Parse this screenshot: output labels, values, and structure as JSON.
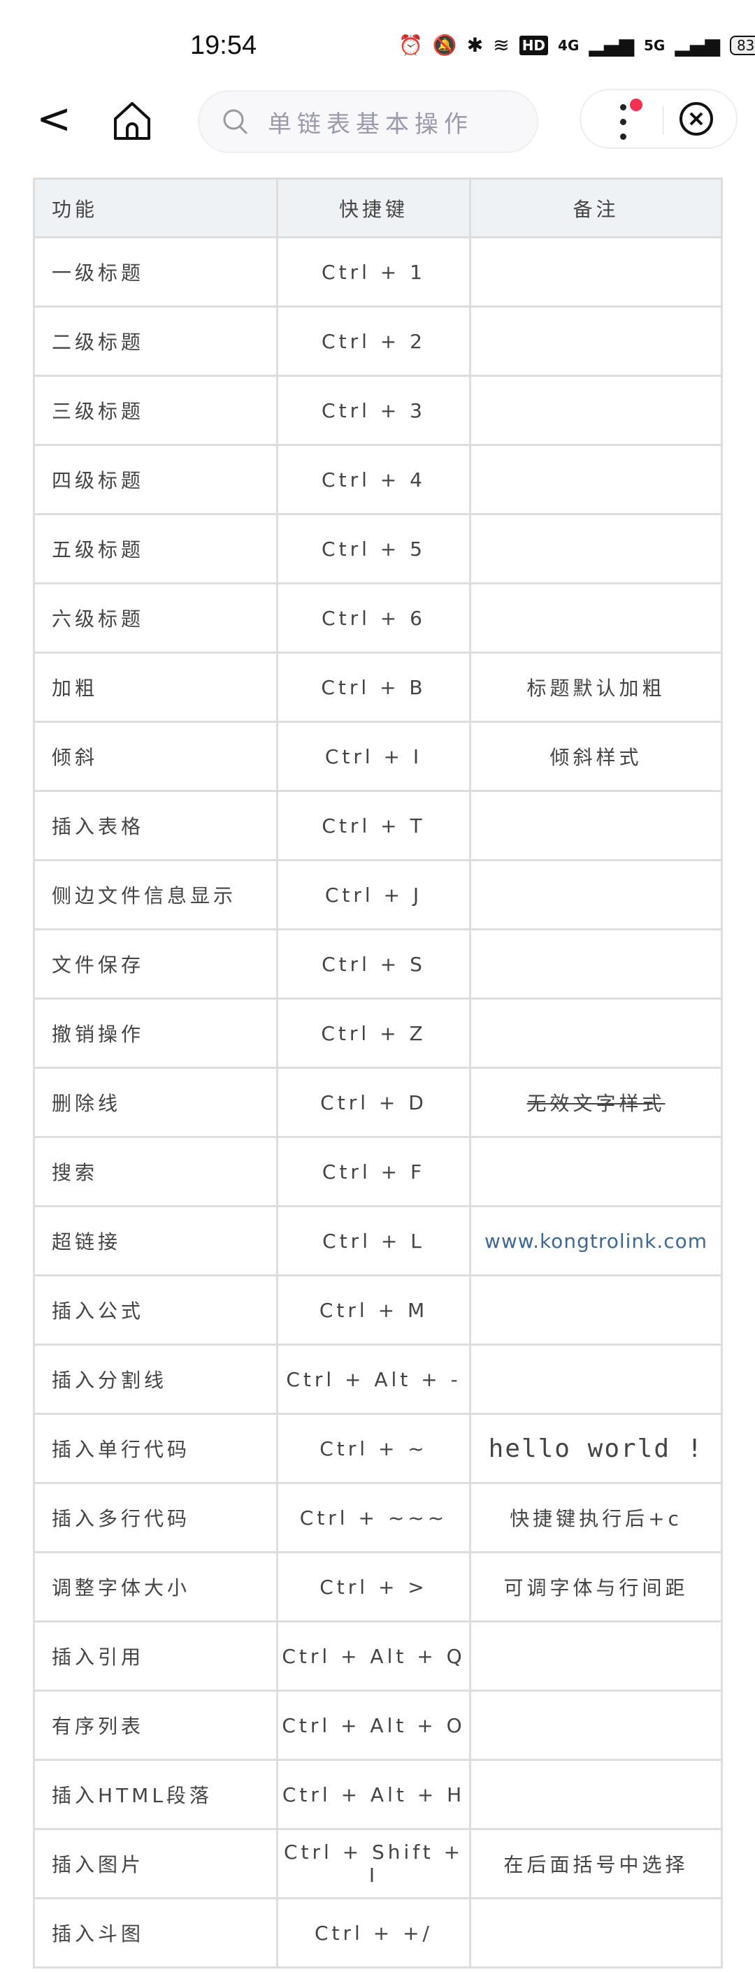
{
  "status_bar": {
    "time": "19:54",
    "battery": "83",
    "network1": "4G",
    "network2": "5G",
    "hd": "HD"
  },
  "nav": {
    "search_placeholder": "单链表基本操作"
  },
  "table": {
    "headers": [
      "功能",
      "快捷键",
      "备注"
    ],
    "rows": [
      {
        "func": "一级标题",
        "key": "Ctrl + 1",
        "note": ""
      },
      {
        "func": "二级标题",
        "key": "Ctrl + 2",
        "note": ""
      },
      {
        "func": "三级标题",
        "key": "Ctrl + 3",
        "note": ""
      },
      {
        "func": "四级标题",
        "key": "Ctrl + 4",
        "note": ""
      },
      {
        "func": "五级标题",
        "key": "Ctrl + 5",
        "note": ""
      },
      {
        "func": "六级标题",
        "key": "Ctrl + 6",
        "note": ""
      },
      {
        "func": "加粗",
        "key": "Ctrl + B",
        "note": "标题默认加粗"
      },
      {
        "func": "倾斜",
        "key": "Ctrl + I",
        "note": "倾斜样式"
      },
      {
        "func": "插入表格",
        "key": "Ctrl + T",
        "note": ""
      },
      {
        "func": "侧边文件信息显示",
        "key": "Ctrl + J",
        "note": ""
      },
      {
        "func": "文件保存",
        "key": "Ctrl + S",
        "note": ""
      },
      {
        "func": "撤销操作",
        "key": "Ctrl + Z",
        "note": ""
      },
      {
        "func": "删除线",
        "key": "Ctrl + D",
        "note": "无效文字样式",
        "style": "strike"
      },
      {
        "func": "搜索",
        "key": "Ctrl + F",
        "note": ""
      },
      {
        "func": "超链接",
        "key": "Ctrl + L",
        "note": "www.kongtrolink.com",
        "style": "link"
      },
      {
        "func": "插入公式",
        "key": "Ctrl + M",
        "note": ""
      },
      {
        "func": "插入分割线",
        "key": "Ctrl + Alt + -",
        "note": ""
      },
      {
        "func": "插入单行代码",
        "key": "Ctrl + ~",
        "note": "hello world !",
        "style": "code"
      },
      {
        "func": "插入多行代码",
        "key": "Ctrl + ~~~",
        "note": "快捷键执行后+c"
      },
      {
        "func": "调整字体大小",
        "key": "Ctrl + >",
        "note": "可调字体与行间距"
      },
      {
        "func": "插入引用",
        "key": "Ctrl + Alt + Q",
        "note": ""
      },
      {
        "func": "有序列表",
        "key": "Ctrl + Alt + O",
        "note": ""
      },
      {
        "func": "插入HTML段落",
        "key": "Ctrl + Alt + H",
        "note": ""
      },
      {
        "func": "插入图片",
        "key": "Ctrl + Shift + I",
        "note": "在后面括号中选择"
      },
      {
        "func": "插入斗图",
        "key": "Ctrl + +/",
        "note": ""
      }
    ]
  }
}
